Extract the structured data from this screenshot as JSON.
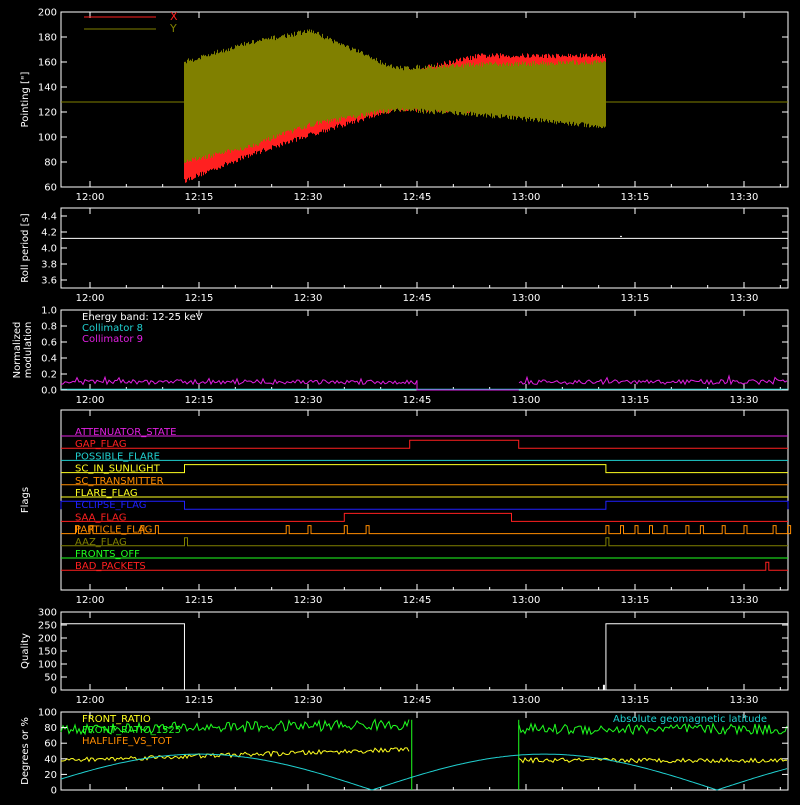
{
  "colors": {
    "background": "#000000",
    "axis": "#ffffff",
    "x_series": "#ff2020",
    "y_series": "#808000",
    "cyan": "#20d0d0",
    "magenta": "#e020e0",
    "yellow": "#ffff20",
    "green": "#20ff20",
    "orange": "#ff8c00",
    "blue": "#2020ff",
    "red": "#ff2020",
    "white": "#ffffff"
  },
  "time_ticks": [
    "12:00",
    "12:15",
    "12:30",
    "12:45",
    "13:00",
    "13:15",
    "13:30"
  ],
  "chart_data": [
    {
      "type": "line",
      "ylabel": "Pointing [\"]",
      "ylim": [
        60,
        200
      ],
      "yticks": [
        60,
        80,
        100,
        120,
        140,
        160,
        180,
        200
      ],
      "legend": "top-left",
      "series": [
        {
          "name": "X",
          "color": "red",
          "baseline": 128,
          "active_start": "12:13",
          "active_end": "13:11",
          "envelope_top": [
            [
              0,
              150
            ],
            [
              0.15,
              168
            ],
            [
              0.3,
              180
            ],
            [
              0.5,
              150
            ],
            [
              0.7,
              165
            ],
            [
              1.0,
              165
            ]
          ],
          "envelope_bottom": [
            [
              0,
              65
            ],
            [
              0.15,
              85
            ],
            [
              0.3,
              102
            ],
            [
              0.5,
              122
            ],
            [
              0.7,
              120
            ],
            [
              1.0,
              115
            ]
          ]
        },
        {
          "name": "Y",
          "color": "olive",
          "baseline": 128,
          "active_start": "12:13",
          "active_end": "13:11",
          "envelope_top": [
            [
              0,
              160
            ],
            [
              0.15,
              175
            ],
            [
              0.3,
              185
            ],
            [
              0.5,
              155
            ],
            [
              0.7,
              158
            ],
            [
              1.0,
              160
            ]
          ],
          "envelope_bottom": [
            [
              0,
              80
            ],
            [
              0.15,
              92
            ],
            [
              0.3,
              110
            ],
            [
              0.5,
              122
            ],
            [
              0.7,
              118
            ],
            [
              1.0,
              108
            ]
          ]
        }
      ]
    },
    {
      "type": "line",
      "ylabel": "Roll period [s]",
      "ylim": [
        3.5,
        4.5
      ],
      "yticks": [
        3.6,
        3.8,
        4.0,
        4.2,
        4.4
      ],
      "series": [
        {
          "name": "",
          "color": "white",
          "value": 4.12
        }
      ]
    },
    {
      "type": "line",
      "ylabel": "Normalized modulation",
      "ylim": [
        0,
        1.0
      ],
      "yticks": [
        0.0,
        0.2,
        0.4,
        0.6,
        0.8,
        1.0
      ],
      "annotations": [
        "Energy band: 12-25 keV",
        "Collimator 8",
        "Collimator 9"
      ],
      "series": [
        {
          "name": "Collimator 8",
          "color": "cyan",
          "value": 0.1
        },
        {
          "name": "Collimator 9",
          "color": "magenta",
          "value": 0.1,
          "gaps": [
            [
              "12:45",
              "12:59"
            ]
          ]
        }
      ]
    },
    {
      "type": "line",
      "ylabel": "Flags",
      "flags": [
        {
          "name": "ATTENUATOR_STATE",
          "color": "magenta",
          "segments": []
        },
        {
          "name": "GAP_FLAG",
          "color": "red",
          "segments": [
            [
              "12:44",
              "12:59"
            ]
          ]
        },
        {
          "name": "POSSIBLE_FLARE",
          "color": "cyan",
          "segments": []
        },
        {
          "name": "SC_IN_SUNLIGHT",
          "color": "yellow",
          "segments": [
            [
              "12:13",
              "13:11"
            ]
          ]
        },
        {
          "name": "SC_TRANSMITTER",
          "color": "orange",
          "segments": []
        },
        {
          "name": "FLARE_FLAG",
          "color": "yellow",
          "segments": []
        },
        {
          "name": "ECLIPSE_FLAG",
          "color": "blue",
          "segments": [
            [
              "11:55",
              "12:13"
            ],
            [
              "13:11",
              "13:38"
            ]
          ]
        },
        {
          "name": "SAA_FLAG",
          "color": "red",
          "segments": [
            [
              "12:35",
              "12:58"
            ]
          ]
        },
        {
          "name": "PARTICLE_FLAG",
          "color": "orange",
          "pulses": [
            "11:58",
            "12:00",
            "12:07",
            "12:09",
            "12:27",
            "12:30",
            "12:35",
            "12:38",
            "13:11",
            "13:13",
            "13:15",
            "13:17",
            "13:19",
            "13:22",
            "13:24",
            "13:27",
            "13:30",
            "13:34",
            "13:36"
          ]
        },
        {
          "name": "AAZ_FLAG",
          "color": "olive",
          "pulses": [
            "12:13",
            "13:11"
          ]
        },
        {
          "name": "FRONTS_OFF",
          "color": "green",
          "segments": []
        },
        {
          "name": "BAD_PACKETS",
          "color": "red",
          "pulses": [
            "13:33"
          ]
        }
      ]
    },
    {
      "type": "line",
      "ylabel": "Quality",
      "ylim": [
        0,
        300
      ],
      "yticks": [
        0,
        50,
        100,
        150,
        200,
        250,
        300
      ],
      "series": [
        {
          "name": "",
          "color": "white",
          "high": 255,
          "low": 0,
          "high_ranges": [
            [
              "11:55",
              "12:13"
            ],
            [
              "13:11",
              "13:38"
            ]
          ]
        }
      ]
    },
    {
      "type": "line",
      "ylabel": "Degrees or %",
      "ylim": [
        0,
        100
      ],
      "yticks": [
        0,
        20,
        40,
        60,
        80,
        100
      ],
      "series": [
        {
          "name": "FRONT_RATIO",
          "color": "yellow",
          "value": 38
        },
        {
          "name": "FRONT_RATIO_1525",
          "color": "green",
          "value": 78
        },
        {
          "name": "HALFLIFE_VS_TOT",
          "color": "orange",
          "value": 30
        },
        {
          "name": "Absolute geomagnetic latitude",
          "color": "cyan",
          "value": "sinusoidal 0-46"
        }
      ],
      "legend_labels": [
        "FRONT_RATIO",
        "FRONT_RATIO_1525",
        "HALFLIFE_VS_TOT"
      ],
      "right_annotation": "Absolute geomagnetic latitude"
    }
  ]
}
